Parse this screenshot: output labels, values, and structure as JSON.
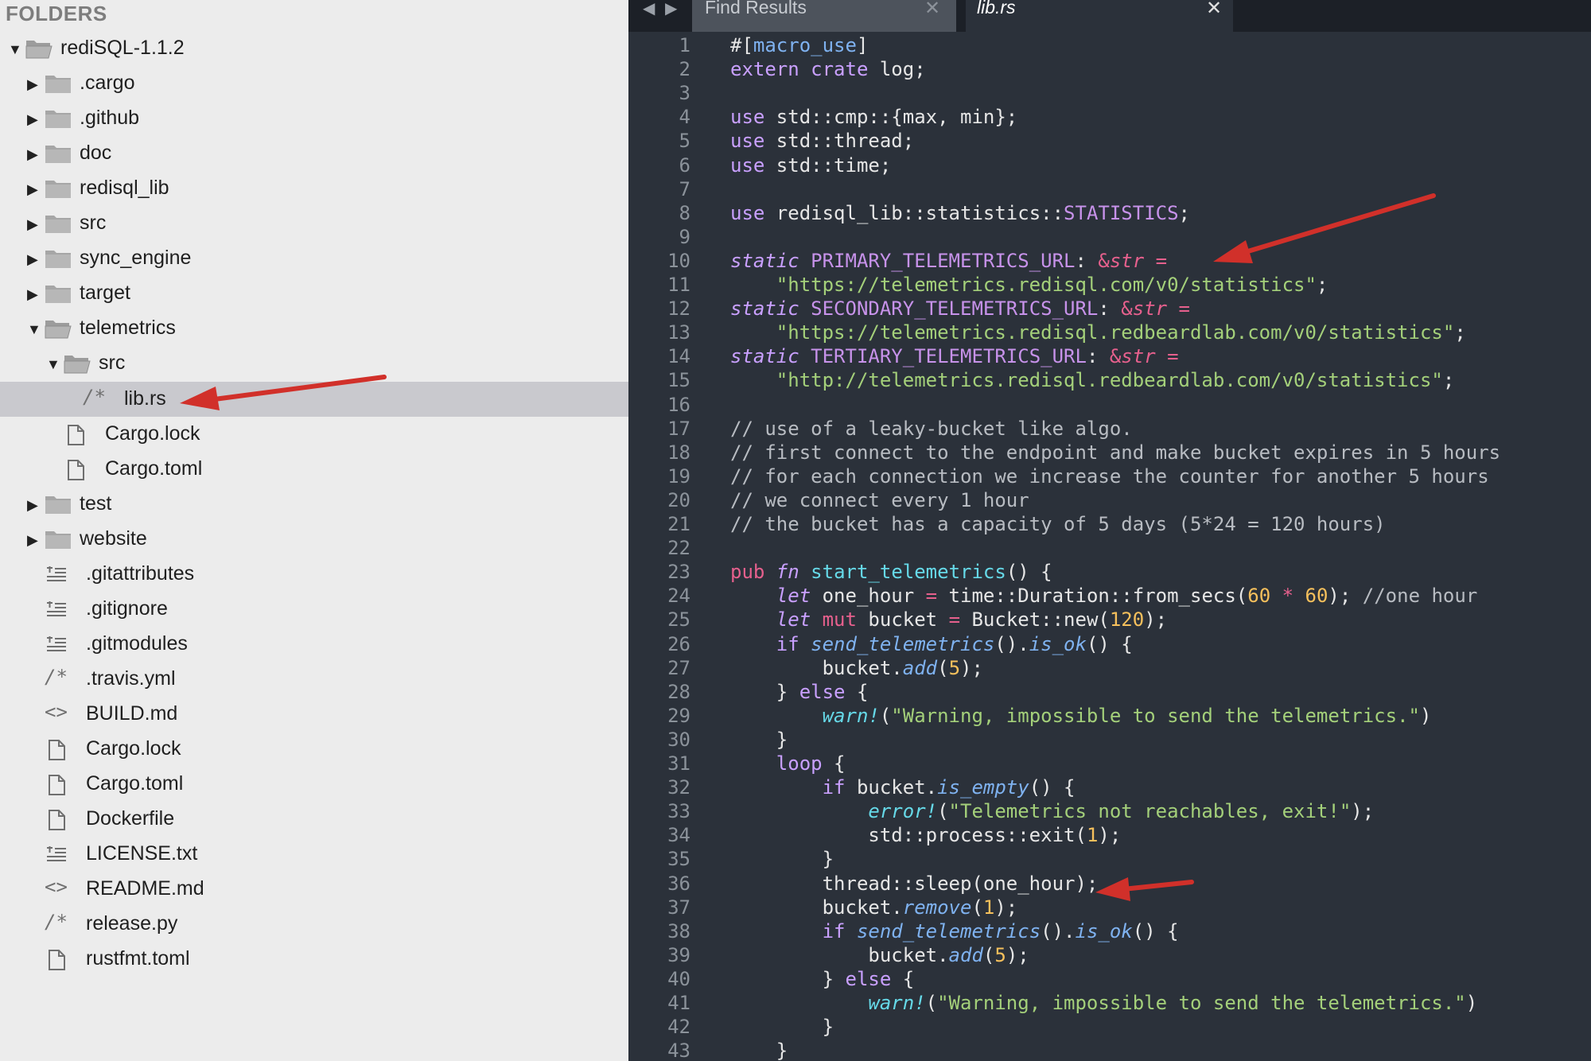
{
  "sidebar": {
    "title": "FOLDERS",
    "items": [
      {
        "label": "rediSQL-1.1.2",
        "level": 0,
        "kind": "folder",
        "state": "open",
        "icon": "folder-open-icon"
      },
      {
        "label": ".cargo",
        "level": 1,
        "kind": "folder",
        "state": "closed",
        "icon": "folder-icon"
      },
      {
        "label": ".github",
        "level": 1,
        "kind": "folder",
        "state": "closed",
        "icon": "folder-icon"
      },
      {
        "label": "doc",
        "level": 1,
        "kind": "folder",
        "state": "closed",
        "icon": "folder-icon"
      },
      {
        "label": "redisql_lib",
        "level": 1,
        "kind": "folder",
        "state": "closed",
        "icon": "folder-icon"
      },
      {
        "label": "src",
        "level": 1,
        "kind": "folder",
        "state": "closed",
        "icon": "folder-icon"
      },
      {
        "label": "sync_engine",
        "level": 1,
        "kind": "folder",
        "state": "closed",
        "icon": "folder-icon"
      },
      {
        "label": "target",
        "level": 1,
        "kind": "folder",
        "state": "closed",
        "icon": "folder-icon"
      },
      {
        "label": "telemetrics",
        "level": 1,
        "kind": "folder",
        "state": "open",
        "icon": "folder-open-icon"
      },
      {
        "label": "src",
        "level": 2,
        "kind": "folder",
        "state": "open",
        "icon": "folder-open-icon"
      },
      {
        "label": "lib.rs",
        "level": 3,
        "kind": "file",
        "icon": "comment-file-icon",
        "glyph": "/*",
        "selected": true
      },
      {
        "label": "Cargo.lock",
        "level": 2,
        "kind": "file",
        "icon": "document-icon"
      },
      {
        "label": "Cargo.toml",
        "level": 2,
        "kind": "file",
        "icon": "document-icon"
      },
      {
        "label": "test",
        "level": 1,
        "kind": "folder",
        "state": "closed",
        "icon": "folder-icon"
      },
      {
        "label": "website",
        "level": 1,
        "kind": "folder",
        "state": "closed",
        "icon": "folder-icon"
      },
      {
        "label": ".gitattributes",
        "level": 1,
        "kind": "file",
        "icon": "text-lines-icon"
      },
      {
        "label": ".gitignore",
        "level": 1,
        "kind": "file",
        "icon": "text-lines-icon"
      },
      {
        "label": ".gitmodules",
        "level": 1,
        "kind": "file",
        "icon": "text-lines-icon"
      },
      {
        "label": ".travis.yml",
        "level": 1,
        "kind": "file",
        "icon": "comment-file-icon",
        "glyph": "/*"
      },
      {
        "label": "BUILD.md",
        "level": 1,
        "kind": "file",
        "icon": "code-brackets-icon",
        "glyph": "<>"
      },
      {
        "label": "Cargo.lock",
        "level": 1,
        "kind": "file",
        "icon": "document-icon"
      },
      {
        "label": "Cargo.toml",
        "level": 1,
        "kind": "file",
        "icon": "document-icon"
      },
      {
        "label": "Dockerfile",
        "level": 1,
        "kind": "file",
        "icon": "document-icon"
      },
      {
        "label": "LICENSE.txt",
        "level": 1,
        "kind": "file",
        "icon": "text-lines-icon"
      },
      {
        "label": "README.md",
        "level": 1,
        "kind": "file",
        "icon": "code-brackets-icon",
        "glyph": "<>"
      },
      {
        "label": "release.py",
        "level": 1,
        "kind": "file",
        "icon": "comment-file-icon",
        "glyph": "/*"
      },
      {
        "label": "rustfmt.toml",
        "level": 1,
        "kind": "file",
        "icon": "document-icon"
      }
    ]
  },
  "tabs": {
    "nav_back": "◀",
    "nav_forward": "▶",
    "close_glyph": "✕",
    "items": [
      {
        "label": "Find Results",
        "active": false
      },
      {
        "label": "lib.rs",
        "active": true
      }
    ]
  },
  "colors": {
    "keyword": "#e6608d",
    "function": "#66d9e8",
    "string": "#a4d07a",
    "number": "#f6c05c",
    "comment": "#b8bcc2",
    "constant": "#c792ea",
    "text": "#e6e6e6",
    "fn_call": "#7fb2f0",
    "use_kw": "#c9a0ff",
    "annotation_arrow": "#d1302a"
  },
  "code": {
    "lines": [
      [
        {
          "t": "#[",
          "c": "text"
        },
        {
          "t": "macro_use",
          "c": "fn_call"
        },
        {
          "t": "]",
          "c": "text"
        }
      ],
      [
        {
          "t": "extern crate",
          "c": "use_kw"
        },
        {
          "t": " log;",
          "c": "text"
        }
      ],
      [],
      [
        {
          "t": "use",
          "c": "use_kw"
        },
        {
          "t": " std::cmp::{max, min};",
          "c": "text"
        }
      ],
      [
        {
          "t": "use",
          "c": "use_kw"
        },
        {
          "t": " std::thread;",
          "c": "text"
        }
      ],
      [
        {
          "t": "use",
          "c": "use_kw"
        },
        {
          "t": " std::time;",
          "c": "text"
        }
      ],
      [],
      [
        {
          "t": "use",
          "c": "use_kw"
        },
        {
          "t": " redisql_lib::statistics::",
          "c": "text"
        },
        {
          "t": "STATISTICS",
          "c": "constant"
        },
        {
          "t": ";",
          "c": "text"
        }
      ],
      [],
      [
        {
          "t": "static",
          "c": "use_kw",
          "i": true
        },
        {
          "t": " PRIMARY_TELEMETRICS_URL",
          "c": "constant"
        },
        {
          "t": ": ",
          "c": "text"
        },
        {
          "t": "&",
          "c": "keyword"
        },
        {
          "t": "str",
          "c": "keyword",
          "i": true
        },
        {
          "t": " = ",
          "c": "keyword"
        }
      ],
      [
        {
          "t": "    \"https://telemetrics.redisql.com/v0/statistics\"",
          "c": "string"
        },
        {
          "t": ";",
          "c": "text"
        }
      ],
      [
        {
          "t": "static",
          "c": "use_kw",
          "i": true
        },
        {
          "t": " SECONDARY_TELEMETRICS_URL",
          "c": "constant"
        },
        {
          "t": ": ",
          "c": "text"
        },
        {
          "t": "&",
          "c": "keyword"
        },
        {
          "t": "str",
          "c": "keyword",
          "i": true
        },
        {
          "t": " = ",
          "c": "keyword"
        }
      ],
      [
        {
          "t": "    \"https://telemetrics.redisql.redbeardlab.com/v0/statistics\"",
          "c": "string"
        },
        {
          "t": ";",
          "c": "text"
        }
      ],
      [
        {
          "t": "static",
          "c": "use_kw",
          "i": true
        },
        {
          "t": " TERTIARY_TELEMETRICS_URL",
          "c": "constant"
        },
        {
          "t": ": ",
          "c": "text"
        },
        {
          "t": "&",
          "c": "keyword"
        },
        {
          "t": "str",
          "c": "keyword",
          "i": true
        },
        {
          "t": " = ",
          "c": "keyword"
        }
      ],
      [
        {
          "t": "    \"http://telemetrics.redisql.redbeardlab.com/v0/statistics\"",
          "c": "string"
        },
        {
          "t": ";",
          "c": "text"
        }
      ],
      [],
      [
        {
          "t": "// use of a leaky-bucket like algo.",
          "c": "comment"
        }
      ],
      [
        {
          "t": "// first connect to the endpoint and make bucket expires in 5 hours",
          "c": "comment"
        }
      ],
      [
        {
          "t": "// for each connection we increase the counter for another 5 hours",
          "c": "comment"
        }
      ],
      [
        {
          "t": "// we connect every 1 hour",
          "c": "comment"
        }
      ],
      [
        {
          "t": "// the bucket has a capacity of 5 days (5*24 = 120 hours)",
          "c": "comment"
        }
      ],
      [],
      [
        {
          "t": "pub",
          "c": "keyword"
        },
        {
          "t": " ",
          "c": "text"
        },
        {
          "t": "fn",
          "c": "use_kw",
          "i": true
        },
        {
          "t": " ",
          "c": "text"
        },
        {
          "t": "start_telemetrics",
          "c": "function"
        },
        {
          "t": "() {",
          "c": "text"
        }
      ],
      [
        {
          "t": "    ",
          "c": "text"
        },
        {
          "t": "let",
          "c": "use_kw",
          "i": true
        },
        {
          "t": " one_hour ",
          "c": "text"
        },
        {
          "t": "=",
          "c": "keyword"
        },
        {
          "t": " time::Duration::from_secs(",
          "c": "text"
        },
        {
          "t": "60",
          "c": "number"
        },
        {
          "t": " ",
          "c": "text"
        },
        {
          "t": "*",
          "c": "keyword"
        },
        {
          "t": " ",
          "c": "text"
        },
        {
          "t": "60",
          "c": "number"
        },
        {
          "t": "); ",
          "c": "text"
        },
        {
          "t": "//one hour",
          "c": "comment"
        }
      ],
      [
        {
          "t": "    ",
          "c": "text"
        },
        {
          "t": "let",
          "c": "use_kw",
          "i": true
        },
        {
          "t": " ",
          "c": "text"
        },
        {
          "t": "mut",
          "c": "keyword"
        },
        {
          "t": " bucket ",
          "c": "text"
        },
        {
          "t": "=",
          "c": "keyword"
        },
        {
          "t": " Bucket::new(",
          "c": "text"
        },
        {
          "t": "120",
          "c": "number"
        },
        {
          "t": ");",
          "c": "text"
        }
      ],
      [
        {
          "t": "    ",
          "c": "text"
        },
        {
          "t": "if",
          "c": "use_kw"
        },
        {
          "t": " ",
          "c": "text"
        },
        {
          "t": "send_telemetrics",
          "c": "fn_call",
          "i": true
        },
        {
          "t": "().",
          "c": "text"
        },
        {
          "t": "is_ok",
          "c": "fn_call",
          "i": true
        },
        {
          "t": "() {",
          "c": "text"
        }
      ],
      [
        {
          "t": "        bucket.",
          "c": "text"
        },
        {
          "t": "add",
          "c": "fn_call",
          "i": true
        },
        {
          "t": "(",
          "c": "text"
        },
        {
          "t": "5",
          "c": "number"
        },
        {
          "t": ");",
          "c": "text"
        }
      ],
      [
        {
          "t": "    } ",
          "c": "text"
        },
        {
          "t": "else",
          "c": "use_kw"
        },
        {
          "t": " {",
          "c": "text"
        }
      ],
      [
        {
          "t": "        ",
          "c": "text"
        },
        {
          "t": "warn!",
          "c": "function",
          "i": true
        },
        {
          "t": "(",
          "c": "text"
        },
        {
          "t": "\"Warning, impossible to send the telemetrics.\"",
          "c": "string"
        },
        {
          "t": ")",
          "c": "text"
        }
      ],
      [
        {
          "t": "    }",
          "c": "text"
        }
      ],
      [
        {
          "t": "    ",
          "c": "text"
        },
        {
          "t": "loop",
          "c": "use_kw"
        },
        {
          "t": " {",
          "c": "text"
        }
      ],
      [
        {
          "t": "        ",
          "c": "text"
        },
        {
          "t": "if",
          "c": "use_kw"
        },
        {
          "t": " bucket.",
          "c": "text"
        },
        {
          "t": "is_empty",
          "c": "fn_call",
          "i": true
        },
        {
          "t": "() {",
          "c": "text"
        }
      ],
      [
        {
          "t": "            ",
          "c": "text"
        },
        {
          "t": "error!",
          "c": "function",
          "i": true
        },
        {
          "t": "(",
          "c": "text"
        },
        {
          "t": "\"Telemetrics not reachables, exit!\"",
          "c": "string"
        },
        {
          "t": ");",
          "c": "text"
        }
      ],
      [
        {
          "t": "            std::process::exit(",
          "c": "text"
        },
        {
          "t": "1",
          "c": "number"
        },
        {
          "t": ");",
          "c": "text"
        }
      ],
      [
        {
          "t": "        }",
          "c": "text"
        }
      ],
      [
        {
          "t": "        thread::sleep(one_hour);",
          "c": "text"
        }
      ],
      [
        {
          "t": "        bucket.",
          "c": "text"
        },
        {
          "t": "remove",
          "c": "fn_call",
          "i": true
        },
        {
          "t": "(",
          "c": "text"
        },
        {
          "t": "1",
          "c": "number"
        },
        {
          "t": ");",
          "c": "text"
        }
      ],
      [
        {
          "t": "        ",
          "c": "text"
        },
        {
          "t": "if",
          "c": "use_kw"
        },
        {
          "t": " ",
          "c": "text"
        },
        {
          "t": "send_telemetrics",
          "c": "fn_call",
          "i": true
        },
        {
          "t": "().",
          "c": "text"
        },
        {
          "t": "is_ok",
          "c": "fn_call",
          "i": true
        },
        {
          "t": "() {",
          "c": "text"
        }
      ],
      [
        {
          "t": "            bucket.",
          "c": "text"
        },
        {
          "t": "add",
          "c": "fn_call",
          "i": true
        },
        {
          "t": "(",
          "c": "text"
        },
        {
          "t": "5",
          "c": "number"
        },
        {
          "t": ");",
          "c": "text"
        }
      ],
      [
        {
          "t": "        } ",
          "c": "text"
        },
        {
          "t": "else",
          "c": "use_kw"
        },
        {
          "t": " {",
          "c": "text"
        }
      ],
      [
        {
          "t": "            ",
          "c": "text"
        },
        {
          "t": "warn!",
          "c": "function",
          "i": true
        },
        {
          "t": "(",
          "c": "text"
        },
        {
          "t": "\"Warning, impossible to send the telemetrics.\"",
          "c": "string"
        },
        {
          "t": ")",
          "c": "text"
        }
      ],
      [
        {
          "t": "        }",
          "c": "text"
        }
      ],
      [
        {
          "t": "    }",
          "c": "text"
        }
      ]
    ]
  }
}
